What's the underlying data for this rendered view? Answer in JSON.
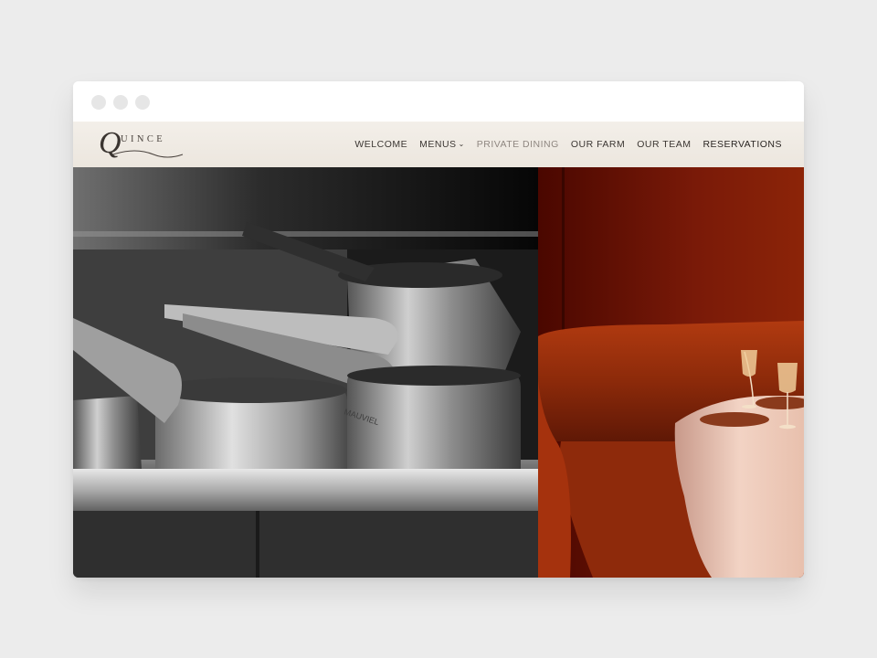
{
  "window": {
    "controls": [
      "close",
      "minimize",
      "maximize"
    ]
  },
  "brand": {
    "logo_text": "UINCE",
    "logo_initial": "Q"
  },
  "nav": {
    "welcome": "WELCOME",
    "menus": "MENUS",
    "menus_chevron": "⌄",
    "private_dining": "PRIVATE DINING",
    "our_farm": "OUR FARM",
    "our_team": "OUR TEAM",
    "reservations": "RESERVATIONS"
  },
  "hero": {
    "left_image": "kitchen-copper-pots-photo",
    "right_image": "dining-booth-table-photo",
    "pot_stamp": "MAUVIEL"
  },
  "colors": {
    "header_bg": "#f3efe9",
    "nav_text": "#3c3733",
    "nav_active": "#8f8780",
    "booth_red": "#7a1e08"
  }
}
